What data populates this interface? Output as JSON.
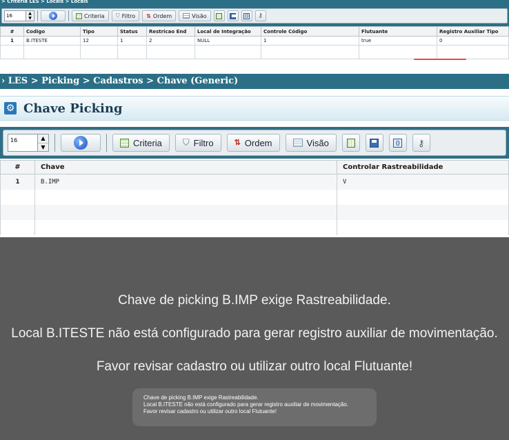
{
  "top_panel": {
    "breadcrumb": "> Criteria LES > Locals > Locals",
    "toolbar": {
      "spin_value": "16",
      "criteria": "Criteria",
      "filtro": "Filtro",
      "ordem": "Ordem",
      "visao": "Visão"
    },
    "columns": [
      "#",
      "Codigo",
      "Tipo",
      "Status",
      "Restricao End",
      "Local de Integração",
      "Controle Código",
      "Flutuante",
      "Registro Auxiliar Tipo"
    ],
    "rows": [
      [
        "1",
        "B.ITESTE",
        "12",
        "1",
        "2",
        "NULL",
        "1",
        "true",
        "0"
      ]
    ]
  },
  "breadcrumb": "› LES > Picking > Cadastros > Chave (Generic)",
  "page_title": "Chave Picking",
  "toolbar": {
    "spin_value": "16",
    "criteria": "Criteria",
    "filtro": "Filtro",
    "ordem": "Ordem",
    "visao": "Visão"
  },
  "grid": {
    "columns": [
      "#",
      "Chave",
      "Controlar Rastreabilidade"
    ],
    "rows": [
      [
        "1",
        "B.IMP",
        "V"
      ]
    ]
  },
  "message": {
    "line1": "Chave de picking B.IMP exige Rastreabilidade.",
    "line2": "Local B.ITESTE não está configurado para gerar registro auxiliar de movimentação.",
    "line3": "Favor revisar cadastro ou utilizar outro local Flutuante!"
  },
  "toast": {
    "line1": "Chave de picking B.IMP exige Rastreabilidade.",
    "line2": "Local B.ITESTE não está configurado para gerar registro auxiliar de movimentação.",
    "line3": "Favor revisar cadastro ou utilizar outro local Flutuante!"
  },
  "colors": {
    "header_blue": "#2a6f86",
    "title_text": "#1d3c52",
    "overlay_gray": "#5a5a5a",
    "accent_red": "#e04a4a"
  }
}
